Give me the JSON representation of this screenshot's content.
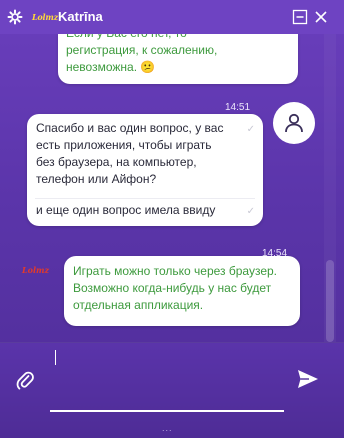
{
  "header": {
    "brand_logo": "Lolmz",
    "agent_name": "Katrīna",
    "icons": [
      "gear-icon",
      "minimize-icon",
      "close-icon"
    ]
  },
  "messages": {
    "m1": {
      "lines": [
        "Если у Вас его нет, то",
        "регистрация, к сожалению,",
        "невозможна. 😕"
      ]
    },
    "m2": {
      "time": "14:51",
      "first": [
        "Спасибо и вас один вопрос, у вас",
        "есть приложения, чтобы играть",
        "без браузера, на компьютер,",
        "телефон или Айфон?"
      ],
      "second": "и еще один вопрос имела ввиду",
      "check": "✓"
    },
    "m3": {
      "time": "14:54",
      "logo": "Lolmz",
      "lines": [
        "Играть можно только через браузер.",
        "Возможно когда-нибудь у нас будет",
        "отдельная аппликация."
      ]
    }
  },
  "composer": {
    "value": "",
    "footer_dots": "..."
  },
  "colors": {
    "header_bg": "#6e43c2",
    "chat_bg": "#5b35aa",
    "agent_text": "#3d9a3d",
    "user_text": "#2a2a3a",
    "brand_yellow": "#ffd83a",
    "brand_red": "#e23a2a"
  }
}
